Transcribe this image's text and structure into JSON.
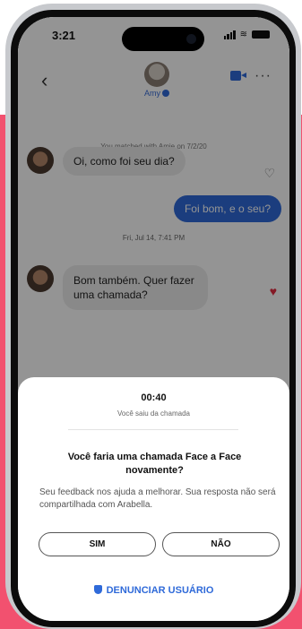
{
  "status_bar": {
    "time": "3:21"
  },
  "header": {
    "back_icon": "chevron-left-icon",
    "contact_name": "Amy",
    "video_icon": "video-call-icon",
    "more_icon": "more-dots-icon"
  },
  "conversation": {
    "system_notice": "You matched with Amie on 7/2/20",
    "messages": [
      {
        "from": "them",
        "text": "Oi, como foi seu dia?",
        "liked": false
      },
      {
        "from": "me",
        "text": "Foi bom, e o seu?"
      },
      {
        "from": "them",
        "text": "Bom também. Quer fazer uma chamada?",
        "liked": true
      }
    ],
    "timestamp": "Fri, Jul 14, 7:41 PM"
  },
  "call_sheet": {
    "duration": "00:40",
    "left_call": "Você saiu da chamada",
    "question": "Você faria uma chamada Face a Face novamente?",
    "feedback": "Seu feedback nos ajuda a melhorar. Sua resposta não será compartilhada com Arabella.",
    "yes_label": "SIM",
    "no_label": "NÃO",
    "report_label": "DENUNCIAR USUÁRIO"
  },
  "colors": {
    "accent": "#2f6ad9",
    "background": "#f2516f",
    "heart": "#e42b40"
  }
}
